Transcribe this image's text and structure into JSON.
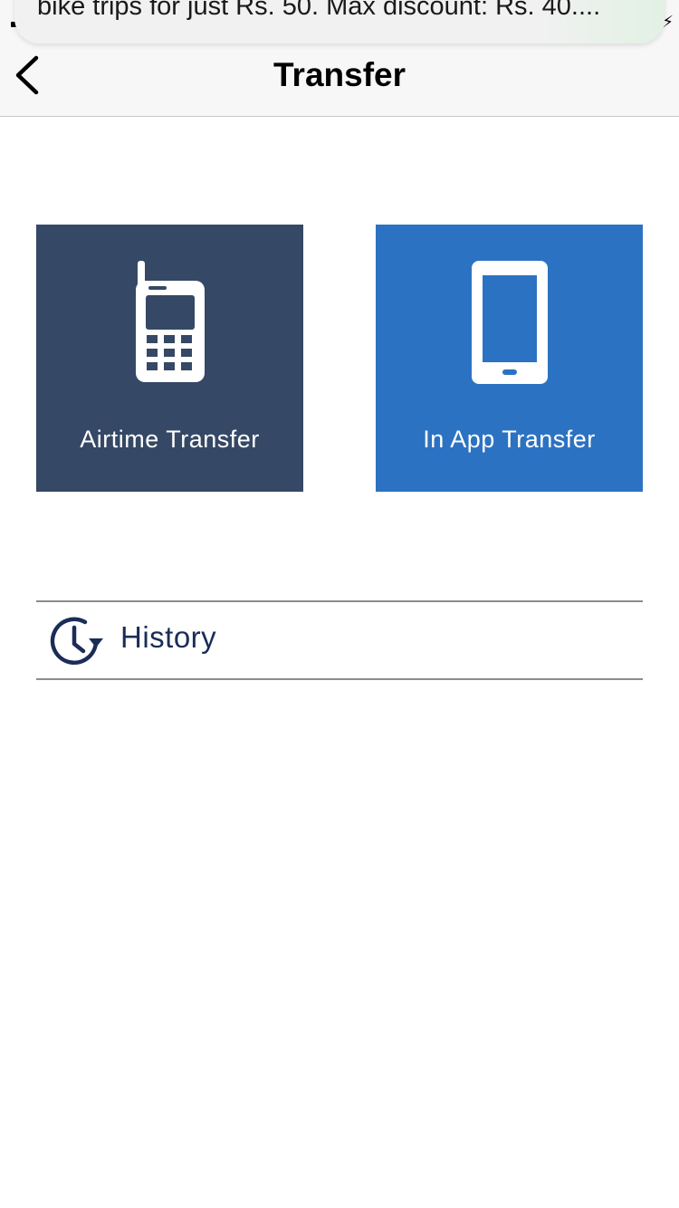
{
  "notification": {
    "text": "bike trips for just Rs. 50. Max discount: Rs. 40...."
  },
  "header": {
    "title": "Transfer",
    "back_icon": "chevron-left-icon"
  },
  "tiles": [
    {
      "label": "Airtime Transfer",
      "icon": "mobile-phone-keypad-icon",
      "color": "#354865"
    },
    {
      "label": "In App Transfer",
      "icon": "smartphone-icon",
      "color": "#2c72c2"
    }
  ],
  "history": {
    "label": "History",
    "icon": "history-clock-icon",
    "color": "#1b2d57"
  }
}
